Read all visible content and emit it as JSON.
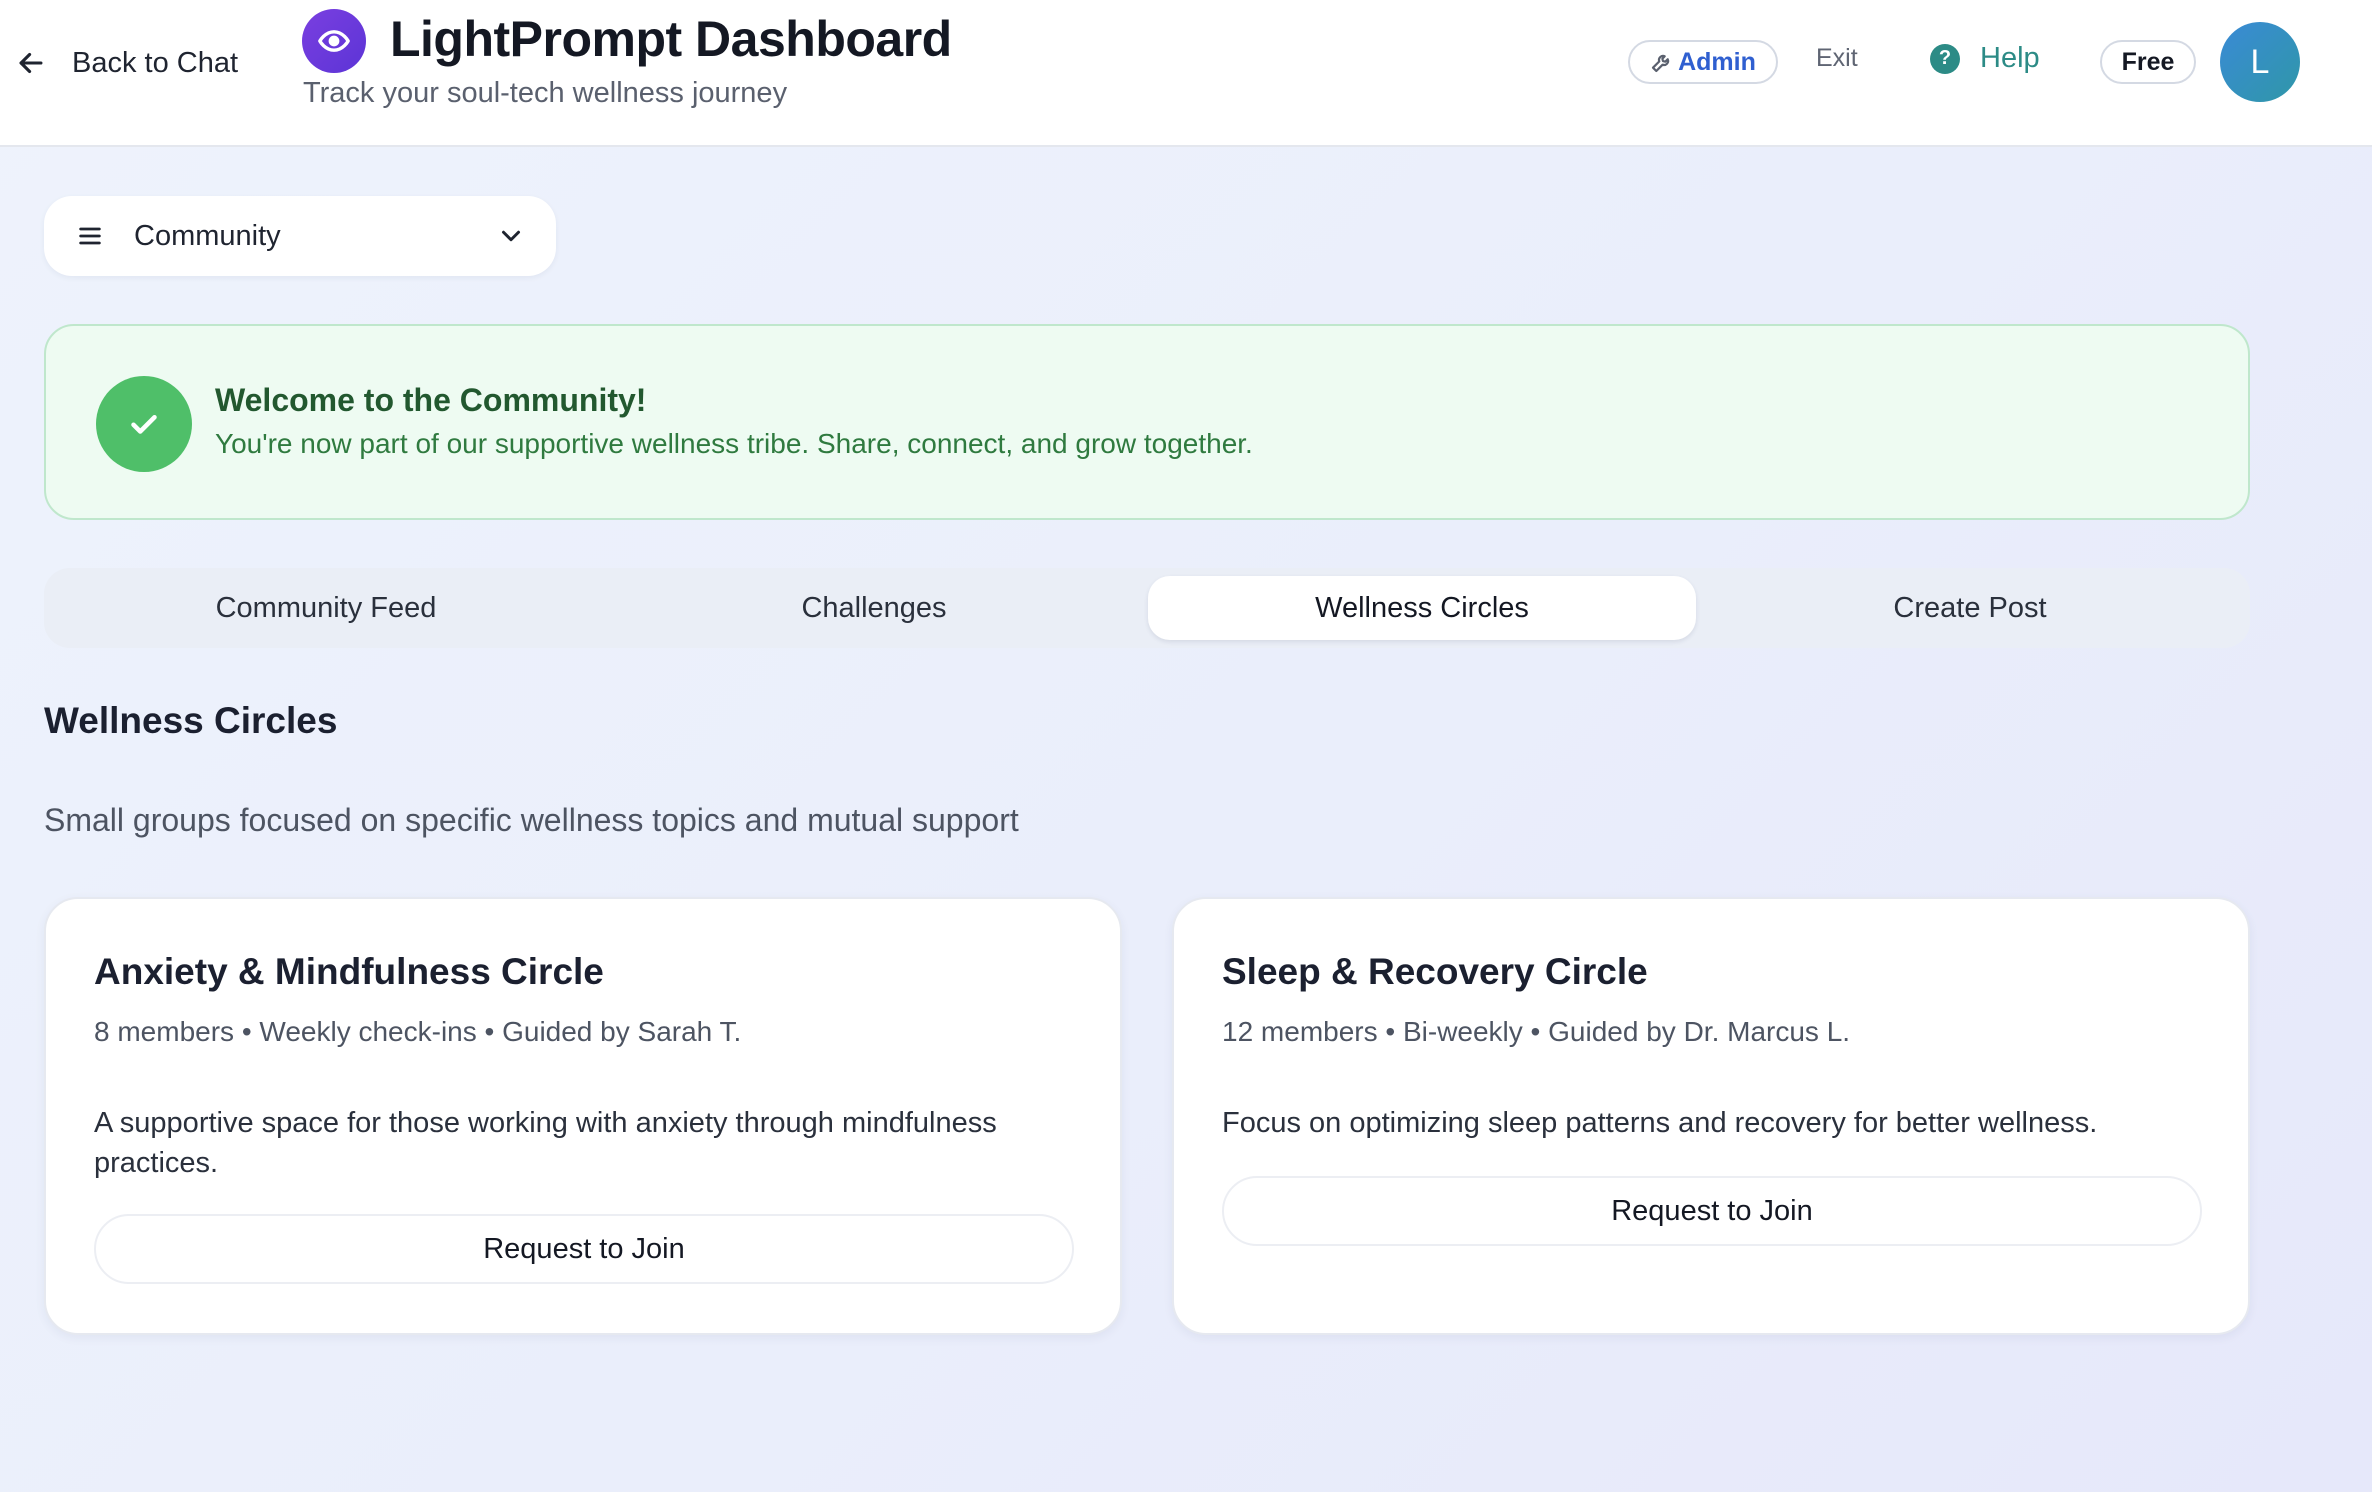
{
  "header": {
    "back_label": "Back to Chat",
    "title": "LightPrompt Dashboard",
    "subtitle": "Track your soul-tech wellness journey",
    "admin_label": "Admin",
    "exit_label": "Exit",
    "help_label": "Help",
    "plan_label": "Free",
    "avatar_initial": "L"
  },
  "section_select": {
    "selected": "Community"
  },
  "welcome": {
    "title": "Welcome to the Community!",
    "text": "You're now part of our supportive wellness tribe. Share, connect, and grow together."
  },
  "tabs": [
    {
      "label": "Community Feed",
      "active": false
    },
    {
      "label": "Challenges",
      "active": false
    },
    {
      "label": "Wellness Circles",
      "active": true
    },
    {
      "label": "Create Post",
      "active": false
    }
  ],
  "circles_section": {
    "title": "Wellness Circles",
    "description": "Small groups focused on specific wellness topics and mutual support"
  },
  "circles": [
    {
      "title": "Anxiety & Mindfulness Circle",
      "meta": "8 members • Weekly check-ins • Guided by Sarah T.",
      "description": "A supportive space for those working with anxiety through mindfulness practices.",
      "button_label": "Request to Join"
    },
    {
      "title": "Sleep & Recovery Circle",
      "meta": "12 members • Bi-weekly • Guided by Dr. Marcus L.",
      "description": "Focus on optimizing sleep patterns and recovery for better wellness.",
      "button_label": "Request to Join"
    }
  ],
  "colors": {
    "brand_purple": "#6a3bdc",
    "help_teal": "#2c8b86",
    "admin_blue": "#2f5fd0",
    "success_green": "#4fbf69"
  }
}
